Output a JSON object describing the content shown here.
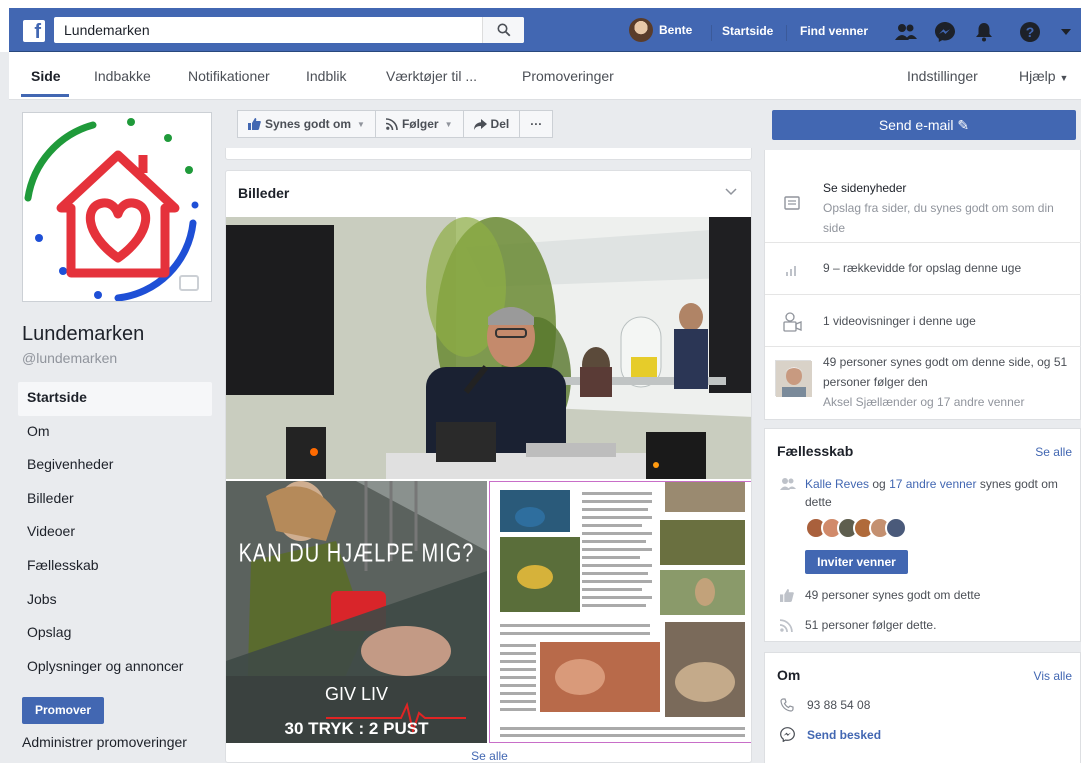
{
  "topbar": {
    "search_value": "Lundemarken",
    "user_name": "Bente",
    "link_home": "Startside",
    "link_find_friends": "Find venner"
  },
  "pagenav": {
    "tabs": [
      "Side",
      "Indbakke",
      "Notifikationer",
      "Indblik",
      "Værktøjer til ...",
      "Promoveringer"
    ],
    "settings": "Indstillinger",
    "help": "Hjælp"
  },
  "left": {
    "page_name": "Lundemarken",
    "page_handle": "@lundemarken",
    "nav": [
      "Startside",
      "Om",
      "Begivenheder",
      "Billeder",
      "Videoer",
      "Fællesskab",
      "Jobs",
      "Opslag",
      "Oplysninger og annoncer"
    ],
    "promote_label": "Promover",
    "admin_promo": "Administrer promoveringer"
  },
  "center": {
    "like_label": "Synes godt om",
    "follow_label": "Følger",
    "share_label": "Del",
    "more_label": "···",
    "photos_title": "Billeder",
    "see_all": "Se alle",
    "poster_title": "KAN DU HJÆLPE MIG?",
    "poster_sub1": "GIV LIV",
    "poster_sub2": "30 TRYK : 2 PUST"
  },
  "right": {
    "send_email": "Send e-mail",
    "news_title": "Se sidenyheder",
    "news_desc": "Opslag fra sider, du synes godt om som din side",
    "reach": "9 – rækkevidde for opslag denne uge",
    "videos": "1 videovisninger i denne uge",
    "likes_follows": "49 personer synes godt om denne side, og 51 personer følger den",
    "friends_like": "Aksel Sjællænder og 17 andre venner",
    "community_title": "Fællesskab",
    "community_see_all": "Se alle",
    "friend_name": "Kalle Reves",
    "friend_and": "og",
    "friend_others": "17 andre venner",
    "friend_suffix": "synes godt om dette",
    "invite_label": "Inviter venner",
    "likes_count": "49 personer synes godt om dette",
    "follows_count": "51 personer følger dette.",
    "about_title": "Om",
    "about_see_all": "Vis alle",
    "phone": "93 88 54 08",
    "send_message": "Send besked"
  },
  "colors": {
    "brand_blue": "#4267b2",
    "logo_red": "#e5323b",
    "logo_blue": "#1e4fd6",
    "logo_green": "#1f9a3a"
  }
}
